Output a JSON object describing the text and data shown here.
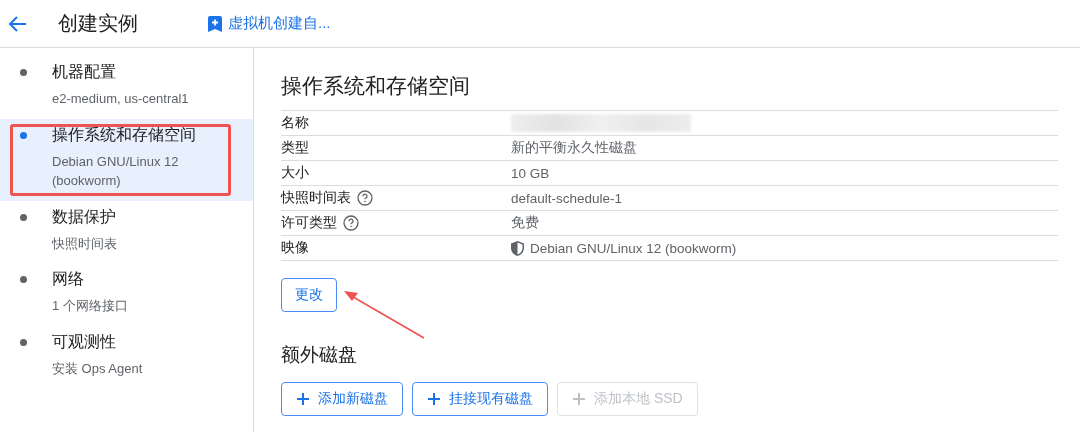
{
  "header": {
    "title": "创建实例",
    "link": "虚拟机创建自..."
  },
  "sidebar": {
    "items": [
      {
        "title": "机器配置",
        "subtitle": "e2-medium, us-central1",
        "selected": false,
        "outlined": false
      },
      {
        "title": "操作系统和存储空间",
        "subtitle": "Debian GNU/Linux 12 (bookworm)",
        "selected": true,
        "outlined": true
      },
      {
        "title": "数据保护",
        "subtitle": "快照时间表",
        "selected": false,
        "outlined": false
      },
      {
        "title": "网络",
        "subtitle": "1 个网络接口",
        "selected": false,
        "outlined": false
      },
      {
        "title": "可观测性",
        "subtitle": "安装 Ops Agent",
        "selected": false,
        "outlined": false
      }
    ]
  },
  "section": {
    "title": "操作系统和存储空间",
    "rows": [
      {
        "label": "名称",
        "help": false,
        "kind": "redacted"
      },
      {
        "label": "类型",
        "help": false,
        "kind": "text",
        "value": "新的平衡永久性磁盘"
      },
      {
        "label": "大小",
        "help": false,
        "kind": "text",
        "value": "10 GB"
      },
      {
        "label": "快照时间表",
        "help": true,
        "kind": "text",
        "value": "default-schedule-1"
      },
      {
        "label": "许可类型",
        "help": true,
        "kind": "text",
        "value": "免费"
      },
      {
        "label": "映像",
        "help": false,
        "kind": "image",
        "value": "Debian GNU/Linux 12 (bookworm)"
      }
    ],
    "button": "更改",
    "arrow": true
  },
  "extra_disks": {
    "title": "额外磁盘",
    "buttons": [
      {
        "label": "添加新磁盘",
        "disabled": false
      },
      {
        "label": "挂接现有磁盘",
        "disabled": false
      },
      {
        "label": "添加本地 SSD",
        "disabled": true
      }
    ]
  }
}
